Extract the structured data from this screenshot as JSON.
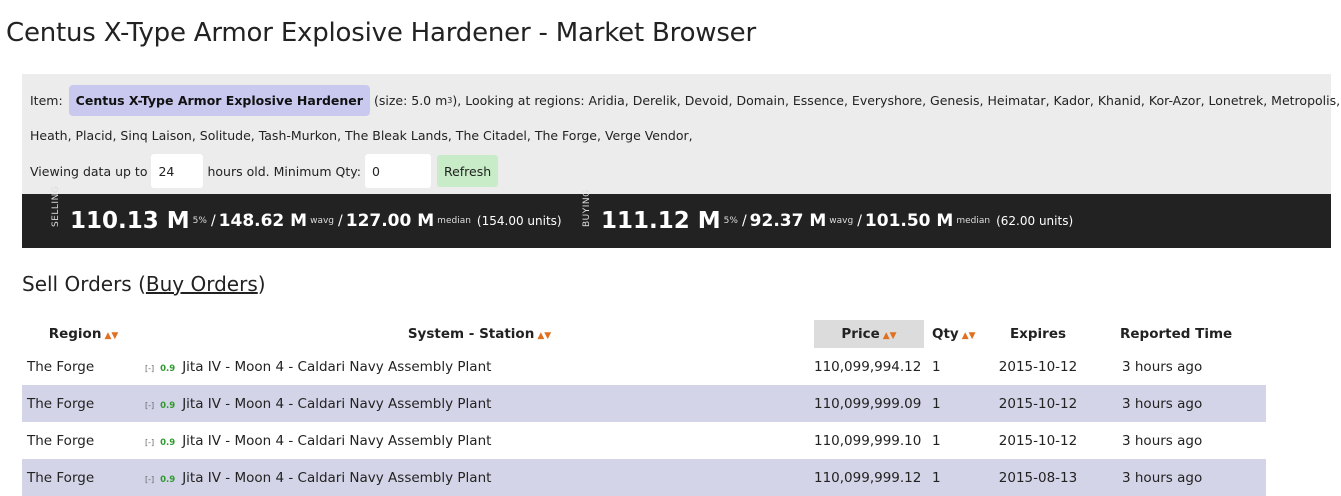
{
  "page": {
    "title": "Centus X-Type Armor Explosive Hardener - Market Browser"
  },
  "info": {
    "item_label": "Item:",
    "item_name": "Centus X-Type Armor Explosive Hardener",
    "size_prefix": "(size: 5.0 m",
    "size_sup": "3",
    "size_suffix": "), Looking at regions: Aridia, Derelik, Devoid, Domain, Essence, Everyshore, Genesis, Heimatar, Kador, Khanid, Kor-Azor, Lonetrek, Metropolis, Molden",
    "regions_line2": "Heath, Placid, Sinq Laison, Solitude, Tash-Murkon, The Bleak Lands, The Citadel, The Forge, Verge Vendor,",
    "viewing_prefix": "Viewing data up to",
    "hours_value": "24",
    "hours_suffix": "hours old. Minimum Qty:",
    "min_qty_value": "0",
    "refresh_label": "Refresh"
  },
  "stats": {
    "selling": {
      "label": "SELLING",
      "p5": "110.13 M",
      "p5_tag": "5%",
      "wavg": "148.62 M",
      "wavg_tag": "wavg",
      "median": "127.00 M",
      "median_tag": "median",
      "units": "(154.00 units)"
    },
    "buying": {
      "label": "BUYING",
      "p5": "111.12 M",
      "p5_tag": "5%",
      "wavg": "92.37 M",
      "wavg_tag": "wavg",
      "median": "101.50 M",
      "median_tag": "median",
      "units": "(62.00 units)"
    },
    "slash": "/"
  },
  "section": {
    "title_prefix": "Sell Orders (",
    "buy_orders_link": "Buy Orders",
    "title_suffix": ")"
  },
  "table": {
    "headers": {
      "region": "Region",
      "station": "System - Station",
      "price": "Price",
      "qty": "Qty",
      "expires": "Expires",
      "reported": "Reported Time"
    },
    "sort_glyph": "▲▼",
    "rows": [
      {
        "region": "The Forge",
        "mini": "[-]",
        "security": "0.9",
        "station": "Jita IV - Moon 4 - Caldari Navy Assembly Plant",
        "price": "110,099,994.12",
        "qty": "1",
        "expires": "2015-10-12",
        "reported": "3 hours ago"
      },
      {
        "region": "The Forge",
        "mini": "[-]",
        "security": "0.9",
        "station": "Jita IV - Moon 4 - Caldari Navy Assembly Plant",
        "price": "110,099,999.09",
        "qty": "1",
        "expires": "2015-10-12",
        "reported": "3 hours ago"
      },
      {
        "region": "The Forge",
        "mini": "[-]",
        "security": "0.9",
        "station": "Jita IV - Moon 4 - Caldari Navy Assembly Plant",
        "price": "110,099,999.10",
        "qty": "1",
        "expires": "2015-10-12",
        "reported": "3 hours ago"
      },
      {
        "region": "The Forge",
        "mini": "[-]",
        "security": "0.9",
        "station": "Jita IV - Moon 4 - Caldari Navy Assembly Plant",
        "price": "110,099,999.12",
        "qty": "1",
        "expires": "2015-08-13",
        "reported": "3 hours ago"
      }
    ]
  },
  "colors": {
    "accent_sort": "#e07020",
    "security_high": "#2e9a2e",
    "row_alt": "#d4d4e8",
    "stats_bg": "#222222",
    "item_chip": "#c9c9f0",
    "refresh_bg": "#c7ecc7"
  }
}
